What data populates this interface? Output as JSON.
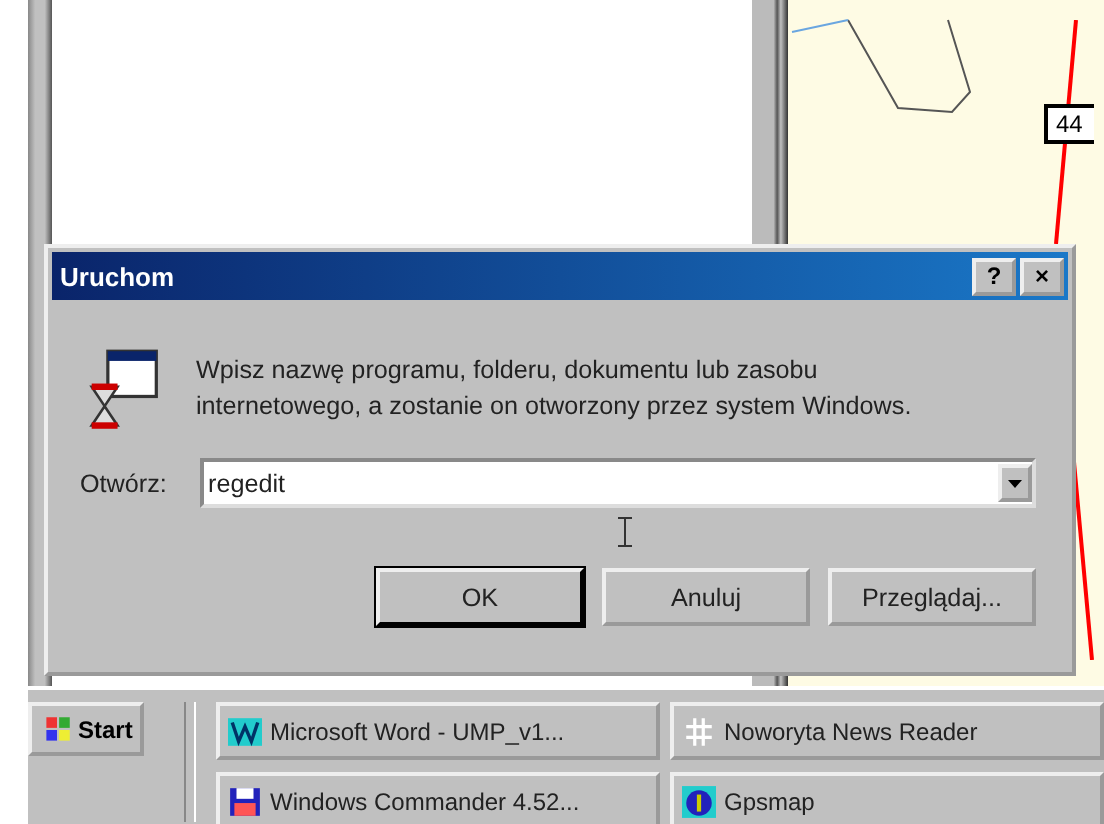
{
  "map": {
    "road_label": "44"
  },
  "dialog": {
    "title": "Uruchom",
    "title_buttons": [
      "?",
      "×"
    ],
    "message": "Wpisz nazwę programu, folderu, dokumentu lub zasobu internetowego, a zostanie on otworzony przez system Windows.",
    "open_label": "Otwórz:",
    "open_value": "regedit",
    "buttons": [
      {
        "label": "OK",
        "default": true
      },
      {
        "label": "Anuluj",
        "default": false
      },
      {
        "label": "Przeglądaj...",
        "default": false
      }
    ]
  },
  "taskbar": {
    "start": "Start",
    "tasks": [
      {
        "label": "Microsoft Word - UMP_v1...",
        "kind": "word"
      },
      {
        "label": "Noworyta News Reader",
        "kind": "news"
      },
      {
        "label": "Windows Commander 4.52...",
        "kind": "commander"
      },
      {
        "label": "Gpsmap",
        "kind": "gps"
      }
    ]
  }
}
